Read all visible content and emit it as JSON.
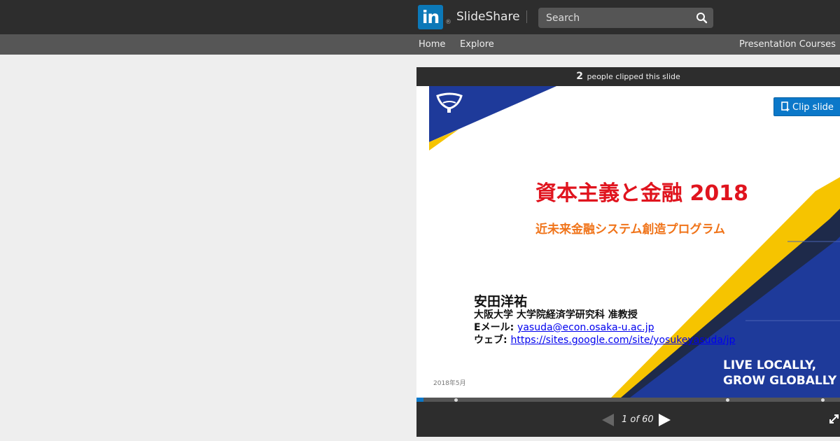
{
  "header": {
    "logo_text": "in",
    "logo_reg": "®",
    "brand": "SlideShare",
    "search_placeholder": "Search"
  },
  "subnav": {
    "home": "Home",
    "explore": "Explore",
    "courses": "Presentation Courses"
  },
  "clipbar": {
    "count": "2",
    "text": "people clipped this slide"
  },
  "slide": {
    "clip_button": "Clip slide",
    "title": "資本主義と金融 2018",
    "subtitle": "近未来金融システム創造プログラム",
    "author": "安田洋祐",
    "affiliation": "大阪大学 大学院経済学研究科 准教授",
    "email_label": "Eメール: ",
    "email": "yasuda@econ.osaka-u.ac.jp",
    "web_label": "ウェブ: ",
    "web": "https://sites.google.com/site/yosukeyasuda/jp",
    "date": "2018年5月",
    "tagline_1": "LIVE LOCALLY,",
    "tagline_2": "GROW GLOBALLY"
  },
  "player": {
    "current_page": 1,
    "total_pages": 60,
    "page_indicator": "1 of 60"
  },
  "colors": {
    "brand_blue": "#0b78b8",
    "title_red": "#e0141e",
    "subtitle_orange": "#f0741a",
    "osaka_blue": "#1e3a9a",
    "accent_yellow": "#f6c400"
  }
}
